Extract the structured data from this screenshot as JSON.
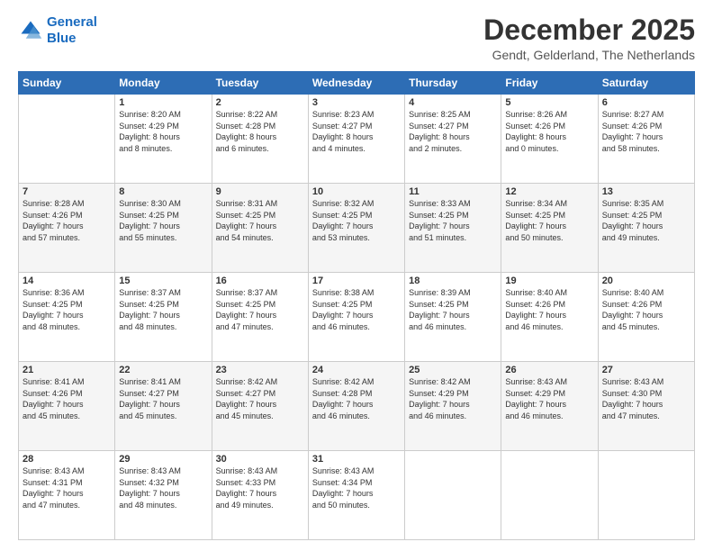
{
  "header": {
    "logo": {
      "line1": "General",
      "line2": "Blue"
    },
    "title": "December 2025",
    "subtitle": "Gendt, Gelderland, The Netherlands"
  },
  "calendar": {
    "weekdays": [
      "Sunday",
      "Monday",
      "Tuesday",
      "Wednesday",
      "Thursday",
      "Friday",
      "Saturday"
    ],
    "weeks": [
      [
        {
          "day": "",
          "info": ""
        },
        {
          "day": "1",
          "info": "Sunrise: 8:20 AM\nSunset: 4:29 PM\nDaylight: 8 hours\nand 8 minutes."
        },
        {
          "day": "2",
          "info": "Sunrise: 8:22 AM\nSunset: 4:28 PM\nDaylight: 8 hours\nand 6 minutes."
        },
        {
          "day": "3",
          "info": "Sunrise: 8:23 AM\nSunset: 4:27 PM\nDaylight: 8 hours\nand 4 minutes."
        },
        {
          "day": "4",
          "info": "Sunrise: 8:25 AM\nSunset: 4:27 PM\nDaylight: 8 hours\nand 2 minutes."
        },
        {
          "day": "5",
          "info": "Sunrise: 8:26 AM\nSunset: 4:26 PM\nDaylight: 8 hours\nand 0 minutes."
        },
        {
          "day": "6",
          "info": "Sunrise: 8:27 AM\nSunset: 4:26 PM\nDaylight: 7 hours\nand 58 minutes."
        }
      ],
      [
        {
          "day": "7",
          "info": "Sunrise: 8:28 AM\nSunset: 4:26 PM\nDaylight: 7 hours\nand 57 minutes."
        },
        {
          "day": "8",
          "info": "Sunrise: 8:30 AM\nSunset: 4:25 PM\nDaylight: 7 hours\nand 55 minutes."
        },
        {
          "day": "9",
          "info": "Sunrise: 8:31 AM\nSunset: 4:25 PM\nDaylight: 7 hours\nand 54 minutes."
        },
        {
          "day": "10",
          "info": "Sunrise: 8:32 AM\nSunset: 4:25 PM\nDaylight: 7 hours\nand 53 minutes."
        },
        {
          "day": "11",
          "info": "Sunrise: 8:33 AM\nSunset: 4:25 PM\nDaylight: 7 hours\nand 51 minutes."
        },
        {
          "day": "12",
          "info": "Sunrise: 8:34 AM\nSunset: 4:25 PM\nDaylight: 7 hours\nand 50 minutes."
        },
        {
          "day": "13",
          "info": "Sunrise: 8:35 AM\nSunset: 4:25 PM\nDaylight: 7 hours\nand 49 minutes."
        }
      ],
      [
        {
          "day": "14",
          "info": "Sunrise: 8:36 AM\nSunset: 4:25 PM\nDaylight: 7 hours\nand 48 minutes."
        },
        {
          "day": "15",
          "info": "Sunrise: 8:37 AM\nSunset: 4:25 PM\nDaylight: 7 hours\nand 48 minutes."
        },
        {
          "day": "16",
          "info": "Sunrise: 8:37 AM\nSunset: 4:25 PM\nDaylight: 7 hours\nand 47 minutes."
        },
        {
          "day": "17",
          "info": "Sunrise: 8:38 AM\nSunset: 4:25 PM\nDaylight: 7 hours\nand 46 minutes."
        },
        {
          "day": "18",
          "info": "Sunrise: 8:39 AM\nSunset: 4:25 PM\nDaylight: 7 hours\nand 46 minutes."
        },
        {
          "day": "19",
          "info": "Sunrise: 8:40 AM\nSunset: 4:26 PM\nDaylight: 7 hours\nand 46 minutes."
        },
        {
          "day": "20",
          "info": "Sunrise: 8:40 AM\nSunset: 4:26 PM\nDaylight: 7 hours\nand 45 minutes."
        }
      ],
      [
        {
          "day": "21",
          "info": "Sunrise: 8:41 AM\nSunset: 4:26 PM\nDaylight: 7 hours\nand 45 minutes."
        },
        {
          "day": "22",
          "info": "Sunrise: 8:41 AM\nSunset: 4:27 PM\nDaylight: 7 hours\nand 45 minutes."
        },
        {
          "day": "23",
          "info": "Sunrise: 8:42 AM\nSunset: 4:27 PM\nDaylight: 7 hours\nand 45 minutes."
        },
        {
          "day": "24",
          "info": "Sunrise: 8:42 AM\nSunset: 4:28 PM\nDaylight: 7 hours\nand 46 minutes."
        },
        {
          "day": "25",
          "info": "Sunrise: 8:42 AM\nSunset: 4:29 PM\nDaylight: 7 hours\nand 46 minutes."
        },
        {
          "day": "26",
          "info": "Sunrise: 8:43 AM\nSunset: 4:29 PM\nDaylight: 7 hours\nand 46 minutes."
        },
        {
          "day": "27",
          "info": "Sunrise: 8:43 AM\nSunset: 4:30 PM\nDaylight: 7 hours\nand 47 minutes."
        }
      ],
      [
        {
          "day": "28",
          "info": "Sunrise: 8:43 AM\nSunset: 4:31 PM\nDaylight: 7 hours\nand 47 minutes."
        },
        {
          "day": "29",
          "info": "Sunrise: 8:43 AM\nSunset: 4:32 PM\nDaylight: 7 hours\nand 48 minutes."
        },
        {
          "day": "30",
          "info": "Sunrise: 8:43 AM\nSunset: 4:33 PM\nDaylight: 7 hours\nand 49 minutes."
        },
        {
          "day": "31",
          "info": "Sunrise: 8:43 AM\nSunset: 4:34 PM\nDaylight: 7 hours\nand 50 minutes."
        },
        {
          "day": "",
          "info": ""
        },
        {
          "day": "",
          "info": ""
        },
        {
          "day": "",
          "info": ""
        }
      ]
    ]
  }
}
